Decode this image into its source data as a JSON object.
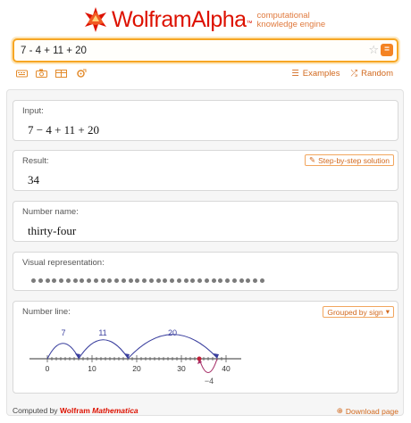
{
  "header": {
    "brand": "WolframAlpha",
    "tagline_line1": "computational",
    "tagline_line2": "knowledge engine",
    "brand_tm": "™"
  },
  "search": {
    "query": "7 - 4 + 11 + 20",
    "go_symbol": "="
  },
  "toolbar": {
    "icons": [
      "keyboard-icon",
      "camera-icon",
      "table-icon",
      "settings-icon"
    ],
    "examples_label": "Examples",
    "random_label": "Random"
  },
  "pods": {
    "input": {
      "title": "Input:",
      "content": "7 − 4 + 11 + 20"
    },
    "result": {
      "title": "Result:",
      "content": "34",
      "step_button": "Step-by-step solution"
    },
    "number_name": {
      "title": "Number name:",
      "content": "thirty-four"
    },
    "visual": {
      "title": "Visual representation:",
      "dot_count": 34
    },
    "number_line": {
      "title": "Number line:",
      "dropdown": "Grouped by sign",
      "jump_labels": [
        "7",
        "11",
        "20",
        "−4"
      ],
      "tick_labels": [
        "0",
        "10",
        "20",
        "30",
        "40"
      ]
    }
  },
  "footer": {
    "computed_by": "Computed by",
    "wolfram": "Wolfram",
    "mathematica": "Mathematica",
    "download": "Download page"
  },
  "colors": {
    "brand_red": "#dd1100",
    "accent_orange": "#f48323",
    "arc_blue": "#3a3f9e",
    "negative_red": "#a8326a"
  }
}
